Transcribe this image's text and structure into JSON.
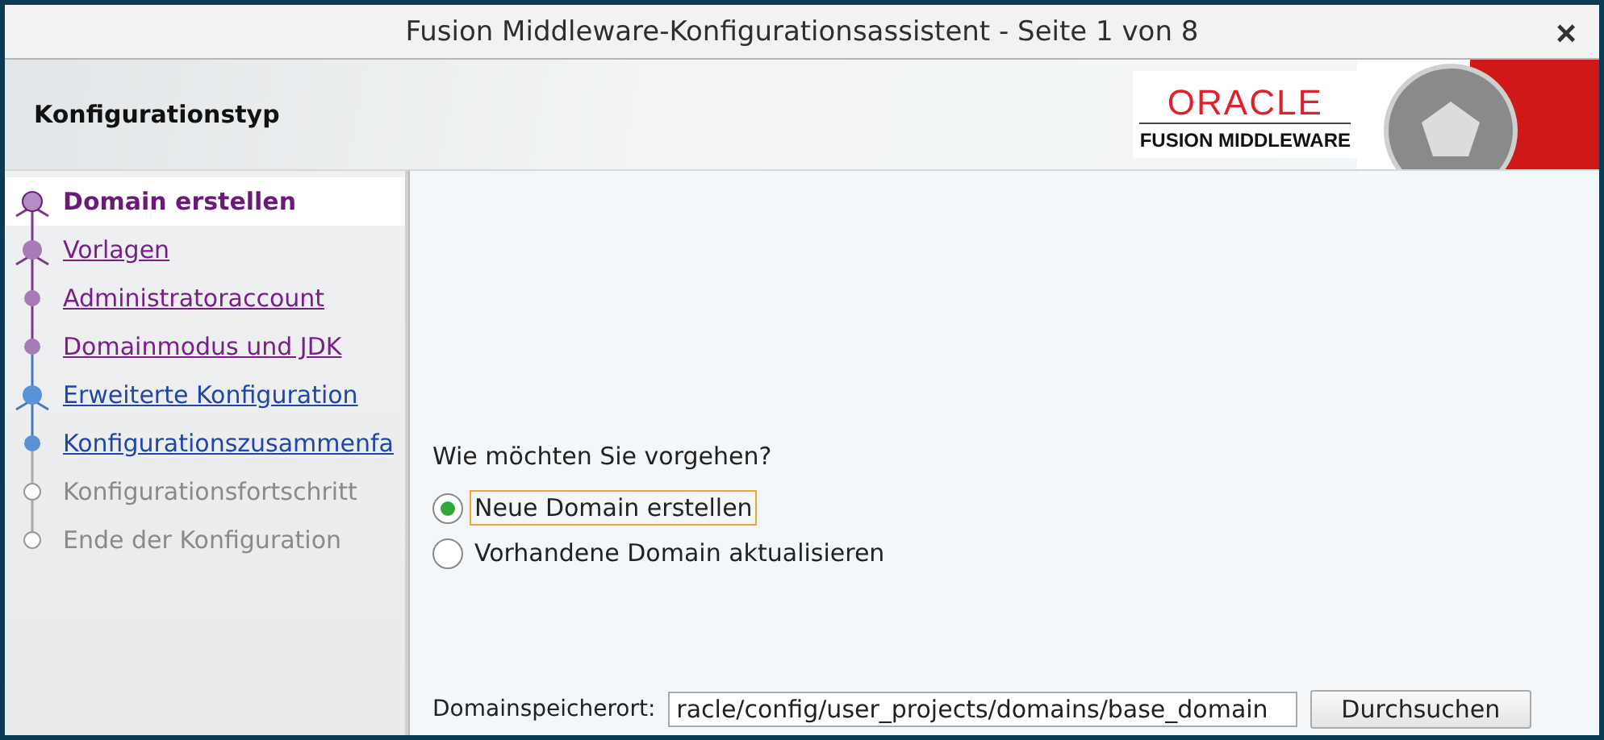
{
  "window": {
    "title": "Fusion Middleware-Konfigurationsassistent - Seite 1 von 8",
    "close": "×"
  },
  "header": {
    "title": "Konfigurationstyp",
    "logo_brand": "ORACLE",
    "logo_product": "FUSION MIDDLEWARE"
  },
  "steps": [
    {
      "label": "Domain erstellen",
      "visited": true,
      "disabled": false,
      "kind": "branch",
      "selected": true
    },
    {
      "label": "Vorlagen",
      "visited": true,
      "disabled": false,
      "kind": "branch",
      "selected": false
    },
    {
      "label": "Administratoraccount",
      "visited": true,
      "disabled": false,
      "kind": "step",
      "selected": false
    },
    {
      "label": "Domainmodus und JDK",
      "visited": true,
      "disabled": false,
      "kind": "step",
      "selected": false
    },
    {
      "label": "Erweiterte Konfiguration",
      "visited": false,
      "disabled": false,
      "kind": "branch",
      "selected": false
    },
    {
      "label": "Konfigurationszusammenfa",
      "visited": false,
      "disabled": false,
      "kind": "step",
      "selected": false
    },
    {
      "label": "Konfigurationsfortschritt",
      "disabled": true,
      "kind": "step",
      "selected": false
    },
    {
      "label": "Ende der Konfiguration",
      "disabled": true,
      "kind": "step",
      "selected": false
    }
  ],
  "question": "Wie möchten Sie vorgehen?",
  "options": [
    {
      "label": "Neue Domain erstellen",
      "selected": true
    },
    {
      "label": "Vorhandene Domain aktualisieren",
      "selected": false
    }
  ],
  "location": {
    "label": "Domainspeicherort:",
    "value": "racle/config/user_projects/domains/base_domain",
    "button": "Durchsuchen"
  }
}
